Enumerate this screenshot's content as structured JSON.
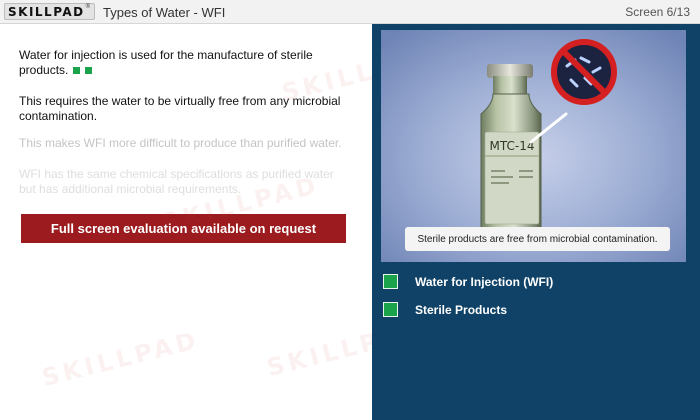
{
  "header": {
    "logo": "SKILLPAD",
    "logo_tm": "®",
    "title": "Types of Water - WFI",
    "screen": "Screen 6/13"
  },
  "content": {
    "p1": "Water for injection is used for the manufacture of sterile products.",
    "p2": "This requires the water to be virtually free from any microbial contamination.",
    "p3": "This makes WFI more difficult to produce than purified water.",
    "p4": "WFI has the same chemical specifications as purified water but has additional microbial requirements.",
    "eval_banner": "Full screen evaluation available on request"
  },
  "image": {
    "vial_label": "MTC-14",
    "caption": "Sterile products are free from microbial contamination."
  },
  "topics": [
    {
      "label": "Water for Injection (WFI)"
    },
    {
      "label": "Sterile Products"
    }
  ],
  "watermark": "SKILLPAD",
  "colors": {
    "accent_green": "#1aa34a",
    "banner_red": "#9b1b1f",
    "panel_blue": "#0f4266",
    "prohibit_red": "#d42020"
  }
}
